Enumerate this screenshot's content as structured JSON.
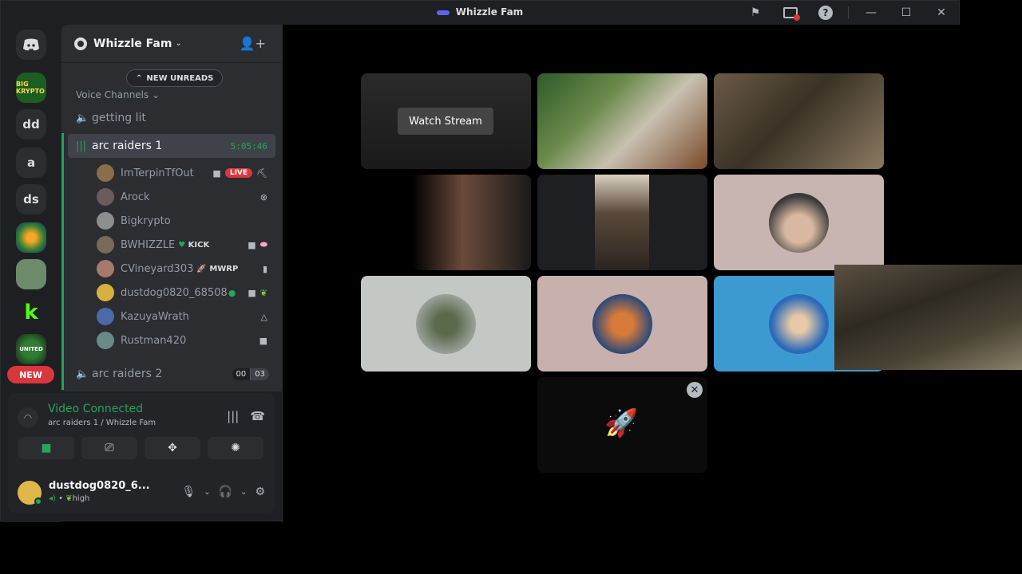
{
  "window": {
    "title": "Whizzle Fam"
  },
  "guilds": {
    "items": [
      {
        "label": "",
        "name": "discord-home"
      },
      {
        "label": "BIG KRYPTO",
        "name": "guild-bigkrypto"
      },
      {
        "label": "dd",
        "name": "guild-dd"
      },
      {
        "label": "a",
        "name": "guild-a"
      },
      {
        "label": "ds",
        "name": "guild-ds"
      },
      {
        "label": "",
        "name": "guild-logo-1"
      },
      {
        "label": "",
        "name": "guild-logo-2"
      },
      {
        "label": "",
        "name": "guild-kick"
      },
      {
        "label": "UNITED",
        "name": "guild-united"
      }
    ],
    "new_badge": "NEW"
  },
  "server": {
    "name": "Whizzle Fam",
    "new_unreads": "NEW UNREADS",
    "category": "Voice Channels",
    "channels": {
      "getting_lit": "getting lit",
      "arc1": {
        "name": "arc raiders 1",
        "timer": "5:05:46"
      },
      "arc2": {
        "name": "arc raiders 2",
        "count_a": "00",
        "count_b": "03"
      }
    },
    "members": [
      {
        "name": "ImTerpinTfOut",
        "live": "LIVE",
        "color": "#8a6d4a"
      },
      {
        "name": "Arock",
        "color": "#6b5b5b"
      },
      {
        "name": "Bigkrypto",
        "color": "#8e8e8e"
      },
      {
        "name": "BWHIZZLE",
        "tag": "KICK",
        "color": "#7a6a5a"
      },
      {
        "name": "CVineyard303",
        "tag": "MWRP",
        "color": "#a57a6a"
      },
      {
        "name": "dustdog0820_68508",
        "color": "#d8b040"
      },
      {
        "name": "KazuyaWrath",
        "color": "#4a6aa8"
      },
      {
        "name": "Rustman420",
        "color": "#6a8a8a"
      }
    ]
  },
  "voice": {
    "status": "Video Connected",
    "location": "arc raiders 1 / Whizzle Fam"
  },
  "user": {
    "name": "dustdog0820_6...",
    "sub": "high"
  },
  "stage": {
    "watch_stream": "Watch Stream"
  }
}
